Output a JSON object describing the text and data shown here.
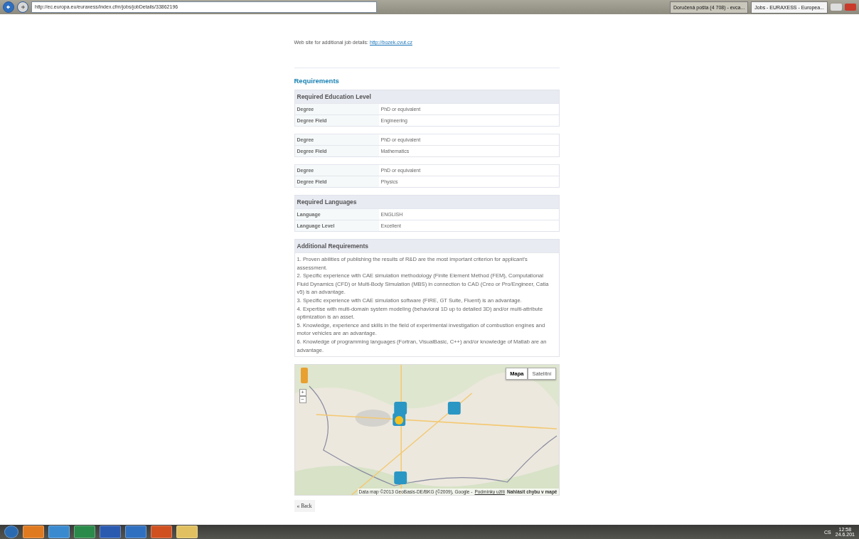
{
  "browser": {
    "address": "http://ec.europa.eu/euraxess/index.cfm/jobs/jobDetails/33862196",
    "tabs": [
      {
        "label": "Doručená pošta (4 708) - evca...",
        "selected": false
      },
      {
        "label": "Jobs - EURAXESS - Europea...",
        "selected": true
      }
    ]
  },
  "page": {
    "website_label": "Web site for additional job details:",
    "website_link": "http://bozek.cvut.cz",
    "section_title": "Requirements",
    "education": {
      "title": "Required Education Level",
      "groups": [
        [
          {
            "label": "Degree",
            "value": "PhD or equivalent"
          },
          {
            "label": "Degree Field",
            "value": "Engineering"
          }
        ],
        [
          {
            "label": "Degree",
            "value": "PhD or equivalent"
          },
          {
            "label": "Degree Field",
            "value": "Mathematics"
          }
        ],
        [
          {
            "label": "Degree",
            "value": "PhD or equivalent"
          },
          {
            "label": "Degree Field",
            "value": "Physics"
          }
        ]
      ]
    },
    "languages": {
      "title": "Required Languages",
      "rows": [
        {
          "label": "Language",
          "value": "ENGLISH"
        },
        {
          "label": "Language Level",
          "value": "Excellent"
        }
      ]
    },
    "additional": {
      "title": "Additional Requirements",
      "items": [
        "1. Proven abilities of publishing the results of R&D are the most important criterion for applicant's assessment.",
        "2. Specific experience with CAE simulation methodology (Finite Element Method (FEM), Computational Fluid Dynamics (CFD) or Multi-Body Simulation (MBS) in connection to CAD (Creo or Pro/Engineer, Catia v5) is an advantage.",
        "3. Specific experience with CAE simulation software (FIRE, GT Suite, Fluent) is an advantage.",
        "4. Expertise with multi-domain system modeling (behavioral 1D up to detailed 3D) and/or multi-attribute optimization is an asset.",
        "5. Knowledge, experience and skills in the field of experimental investigation of combustion engines and motor vehicles are an advantage.",
        "6. Knowledge of programming languages (Fortran, VisualBasic, C++) and/or knowledge of Matlab are an advantage."
      ]
    },
    "map": {
      "kind": "picture",
      "map_types": [
        {
          "label": "Mapa",
          "selected": true
        },
        {
          "label": "Satelitní",
          "selected": false
        }
      ],
      "zoom_in": "+",
      "zoom_out": "−",
      "attribution": "Data map ©2013 GeoBasis-DE/BKG (©2009), Google -",
      "terms_link": "Podmínky užití",
      "report_link": "Nahlásit chybu v mapě"
    },
    "back_button": "« Back"
  },
  "taskbar": {
    "language": "CS",
    "time": "12:58",
    "date": "24.6.201"
  }
}
